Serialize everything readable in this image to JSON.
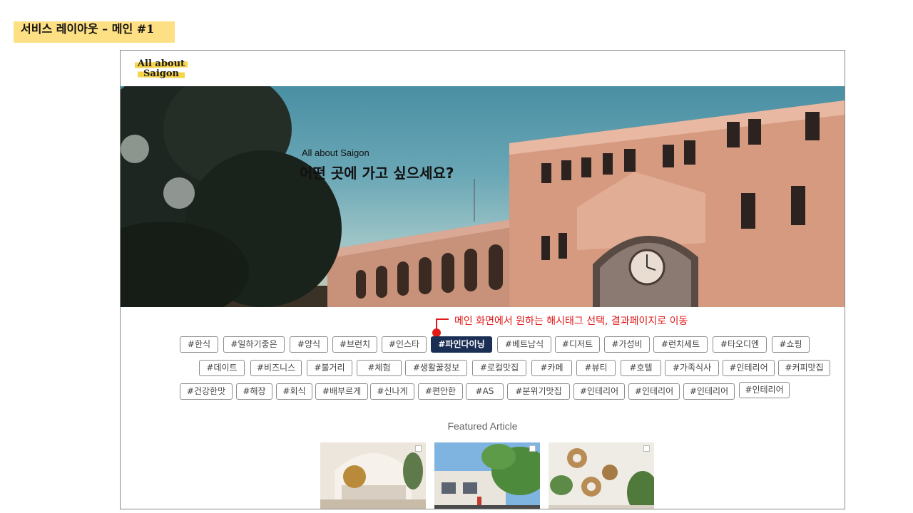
{
  "page_label": "서비스 레이아웃 – 메인 #1",
  "header": {
    "logo_line1": "All about",
    "logo_line2": "Saigon"
  },
  "hero": {
    "subtitle": "All about Saigon",
    "title": "어떤 곳에 가고 싶으세요?"
  },
  "annotation": {
    "text": "메인 화면에서 원하는 해시태그 선택, 결과페이지로 이동",
    "color": "#e11a1a"
  },
  "hashtags": {
    "row1": [
      "#한식",
      "#일하기좋은",
      "#양식",
      "#브런치",
      "#인스타",
      "#파인다이닝",
      "#베트남식",
      "#디저트",
      "#가성비",
      "#런치세트",
      "#타오디엔",
      "#쇼핑"
    ],
    "row2": [
      "#데이트",
      "#비즈니스",
      "#불거리",
      "#체험",
      "#생활꿀정보",
      "#로컬맛집",
      "#카페",
      "#뷰티",
      "#호텔",
      "#가족식사",
      "#인테리어",
      "#커피맛집"
    ],
    "row3": [
      "#건강한맛",
      "#해장",
      "#회식",
      "#배부르게",
      "#신나게",
      "#편안한",
      "#AS",
      "#분위기맛집",
      "#인테리어",
      "#인테리어",
      "#인테리어",
      "#인테리어"
    ],
    "selected": "#파인다이닝",
    "selected_color": "#1b2f55"
  },
  "featured": {
    "title": "Featured Article"
  },
  "colors": {
    "label_highlight": "#fde083",
    "logo_highlight": "#f7d54a"
  }
}
